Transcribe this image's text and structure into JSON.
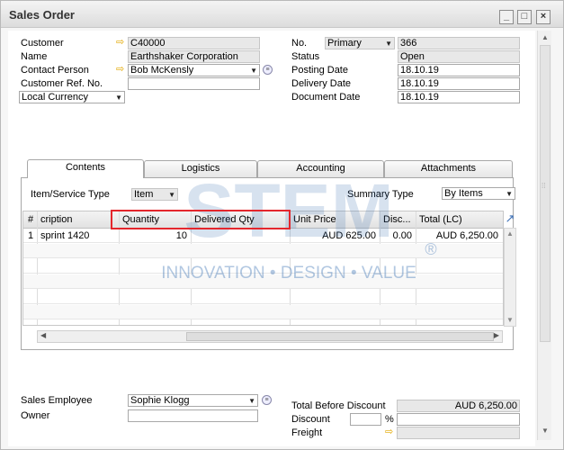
{
  "window": {
    "title": "Sales Order"
  },
  "header_left": {
    "customer": {
      "label": "Customer",
      "value": "C40000"
    },
    "name": {
      "label": "Name",
      "value": "Earthshaker Corporation"
    },
    "contact_person": {
      "label": "Contact Person",
      "value": "Bob McKensly"
    },
    "customer_ref": {
      "label": "Customer Ref. No.",
      "value": ""
    },
    "currency": {
      "value": "Local Currency"
    }
  },
  "header_right": {
    "no": {
      "label": "No.",
      "series": "Primary",
      "value": "366"
    },
    "status": {
      "label": "Status",
      "value": "Open"
    },
    "posting_date": {
      "label": "Posting Date",
      "value": "18.10.19"
    },
    "delivery_date": {
      "label": "Delivery Date",
      "value": "18.10.19"
    },
    "document_date": {
      "label": "Document Date",
      "value": "18.10.19"
    }
  },
  "tabs": [
    "Contents",
    "Logistics",
    "Accounting",
    "Attachments"
  ],
  "contents": {
    "item_service_type": {
      "label": "Item/Service Type",
      "value": "Item"
    },
    "summary_type": {
      "label": "Summary Type",
      "value": "By Items"
    },
    "columns": [
      "#",
      "cription",
      "Quantity",
      "Delivered Qty",
      "Unit Price",
      "Disc...",
      "Total (LC)"
    ],
    "rows": [
      {
        "num": "1",
        "description": "sprint 1420",
        "quantity": "10",
        "delivered": "",
        "unit_price": "AUD 625.00",
        "discount": "0.00",
        "total": "AUD 6,250.00"
      }
    ]
  },
  "footer_left": {
    "sales_employee": {
      "label": "Sales Employee",
      "value": "Sophie Klogg"
    },
    "owner": {
      "label": "Owner",
      "value": ""
    }
  },
  "footer_right": {
    "total_before_discount": {
      "label": "Total Before Discount",
      "value": "AUD 6,250.00"
    },
    "discount": {
      "label": "Discount",
      "value": "",
      "unit": "%"
    },
    "freight": {
      "label": "Freight",
      "value": ""
    }
  },
  "watermark": {
    "logo": "STEM",
    "tagline": "INNOVATION • DESIGN • VALUE",
    "reg": "®"
  },
  "colors": {
    "highlight": "#e4262c",
    "link_arrow": "#e3a800",
    "watermark": "#1f5ea8"
  }
}
